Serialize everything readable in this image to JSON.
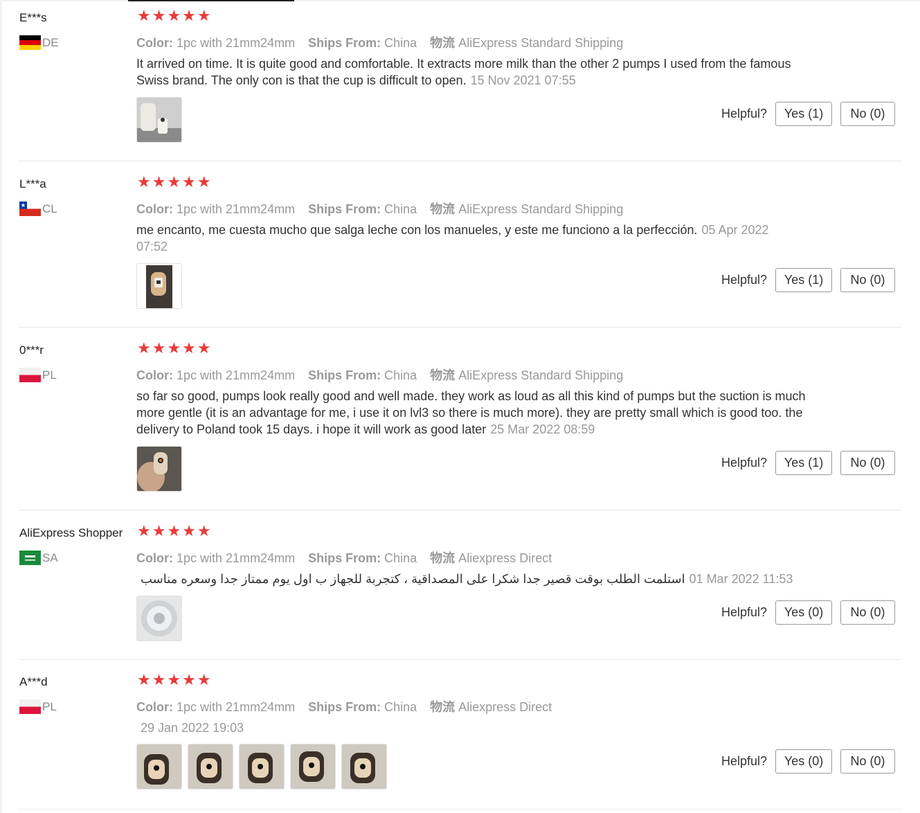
{
  "reviews": [
    {
      "user": "E***s",
      "country": "DE",
      "stars": "★★★★★",
      "color_label": "Color:",
      "color_value": "1pc with 21mm24mm",
      "ships_label": "Ships From:",
      "ships_value": "China",
      "logistics_label": "物流",
      "logistics_value": "AliExpress Standard Shipping",
      "text": "It arrived on time. It is quite good and comfortable. It extracts more milk than the other 2 pumps I used from the famous Swiss brand. The only con is that the cup is difficult to open.",
      "date": "15 Nov 2021 07:55",
      "helpful_label": "Helpful?",
      "yes": "Yes (1)",
      "no": "No (0)"
    },
    {
      "user": "L***a",
      "country": "CL",
      "stars": "★★★★★",
      "color_label": "Color:",
      "color_value": "1pc with 21mm24mm",
      "ships_label": "Ships From:",
      "ships_value": "China",
      "logistics_label": "物流",
      "logistics_value": "AliExpress Standard Shipping",
      "text": "me encanto, me cuesta mucho que salga leche con los manueles, y este me funciono a la perfección.",
      "date": "05 Apr 2022 07:52",
      "helpful_label": "Helpful?",
      "yes": "Yes (1)",
      "no": "No (0)"
    },
    {
      "user": "0***r",
      "country": "PL",
      "stars": "★★★★★",
      "color_label": "Color:",
      "color_value": "1pc with 21mm24mm",
      "ships_label": "Ships From:",
      "ships_value": "China",
      "logistics_label": "物流",
      "logistics_value": "AliExpress Standard Shipping",
      "text": "so far so good, pumps look really good and well made. they work as loud as all this kind of pumps but the suction is much more gentle (it is an advantage for me, i use it on lvl3 so there is much more). they are pretty small which is good too. the delivery to Poland took 15 days. i hope it will work as good later",
      "date": "25 Mar 2022 08:59",
      "helpful_label": "Helpful?",
      "yes": "Yes (1)",
      "no": "No (0)"
    },
    {
      "user": "AliExpress Shopper",
      "country": "SA",
      "stars": "★★★★★",
      "color_label": "Color:",
      "color_value": "1pc with 21mm24mm",
      "ships_label": "Ships From:",
      "ships_value": "China",
      "logistics_label": "物流",
      "logistics_value": "Aliexpress Direct",
      "text": "استلمت الطلب بوقت قصير جدا شكرا على المصداقية ، كتجربة للجهاز ب اول يوم ممتاز جدا وسعره مناسب",
      "date": "01 Mar 2022 11:53",
      "helpful_label": "Helpful?",
      "yes": "Yes (0)",
      "no": "No (0)"
    },
    {
      "user": "A***d",
      "country": "PL",
      "stars": "★★★★★",
      "color_label": "Color:",
      "color_value": "1pc with 21mm24mm",
      "ships_label": "Ships From:",
      "ships_value": "China",
      "logistics_label": "物流",
      "logistics_value": "Aliexpress Direct",
      "text": "",
      "date": "29 Jan 2022 19:03",
      "helpful_label": "Helpful?",
      "yes": "Yes (0)",
      "no": "No (0)"
    }
  ]
}
